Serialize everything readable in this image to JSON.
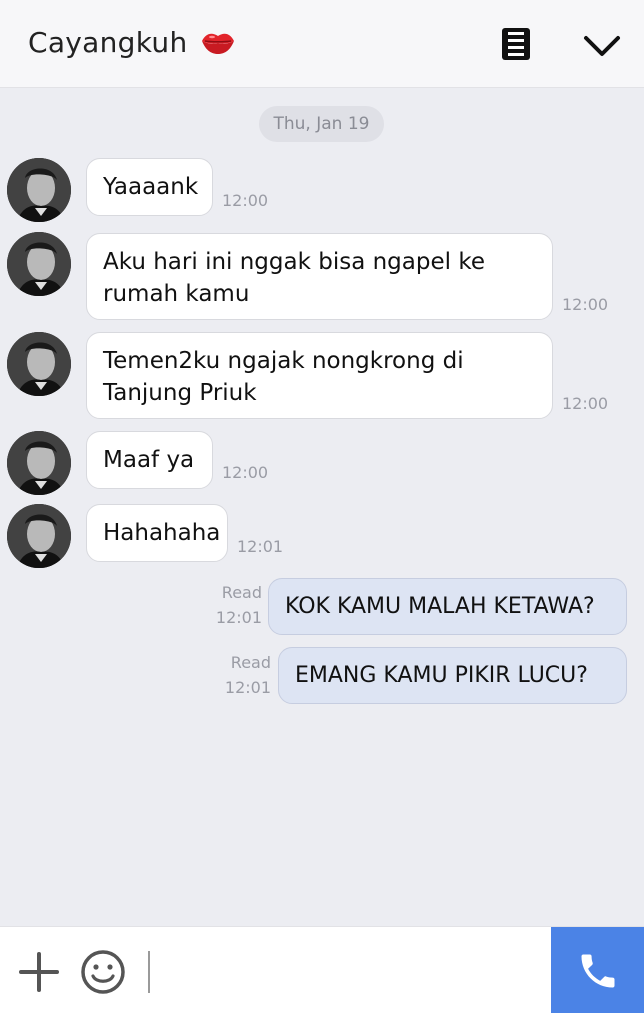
{
  "header": {
    "title": "Cayangkuh",
    "title_icon": "lips-kiss-icon",
    "menu_icon": "menu-icon",
    "collapse_icon": "chevron-down-icon"
  },
  "date_separator": "Thu, Jan 19",
  "messages": [
    {
      "from": "contact",
      "text": "Yaaaank",
      "time": "12:00"
    },
    {
      "from": "contact",
      "lines": [
        "Aku hari ini nggak bisa ngapel ke",
        "rumah kamu"
      ],
      "time": "12:00"
    },
    {
      "from": "contact",
      "lines": [
        "Temen2ku ngajak nongkrong di",
        "Tanjung Priuk"
      ],
      "time": "12:00"
    },
    {
      "from": "contact",
      "text": "Maaf ya",
      "time": "12:00"
    },
    {
      "from": "contact",
      "text": "Hahahaha",
      "time": "12:01"
    },
    {
      "from": "me",
      "text": "KOK KAMU MALAH KETAWA?",
      "status": "Read",
      "time": "12:01"
    },
    {
      "from": "me",
      "text": "EMANG KAMU PIKIR LUCU?",
      "status": "Read",
      "time": "12:01"
    }
  ],
  "footer": {
    "add_icon": "plus-icon",
    "emoji_icon": "smiley-icon",
    "call_icon": "phone-icon"
  },
  "colors": {
    "background": "#ecedf2",
    "outgoing_bubble": "#dde4f3",
    "incoming_bubble": "#ffffff",
    "call_button": "#4b83e6"
  }
}
